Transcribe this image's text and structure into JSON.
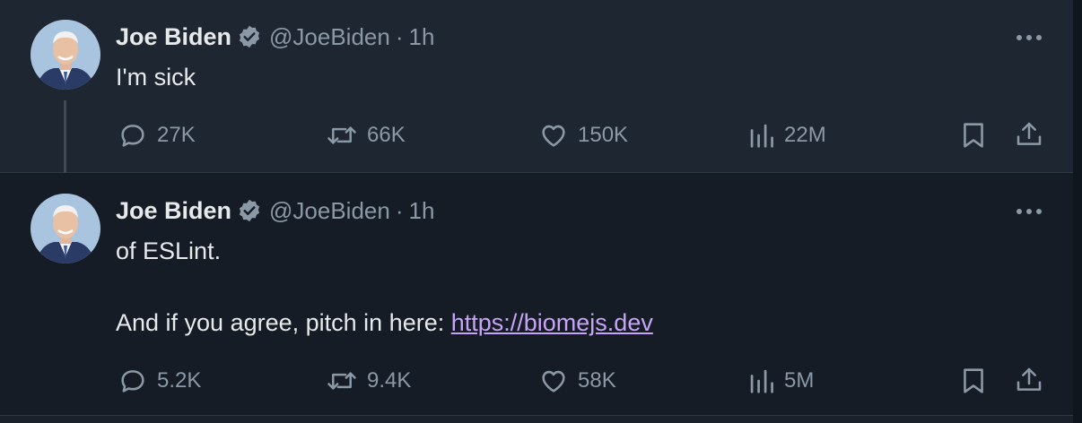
{
  "tweets": [
    {
      "author": {
        "name": "Joe Biden",
        "handle": "@JoeBiden",
        "verified": true
      },
      "separator": "·",
      "time": "1h",
      "text_lines": [
        "I'm sick"
      ],
      "link": "",
      "stats": {
        "replies": "27K",
        "reposts": "66K",
        "likes": "150K",
        "views": "22M"
      }
    },
    {
      "author": {
        "name": "Joe Biden",
        "handle": "@JoeBiden",
        "verified": true
      },
      "separator": "·",
      "time": "1h",
      "text_lines": [
        "of ESLint.",
        "",
        "And if you agree, pitch in here: "
      ],
      "link": "https://biomejs.dev",
      "stats": {
        "replies": "5.2K",
        "reposts": "9.4K",
        "likes": "58K",
        "views": "5M"
      }
    }
  ],
  "icons": {
    "reply": "speech-bubble-icon",
    "repost": "retweet-arrows-icon",
    "like": "heart-icon",
    "views": "bar-chart-icon",
    "bookmark": "bookmark-icon",
    "share": "share-upload-icon",
    "more": "three-dots-icon",
    "verified": "verified-badge-icon"
  },
  "colors": {
    "background_first": "#1e2631",
    "background_second": "#151c25",
    "text": "#e7e9ea",
    "muted": "#8b98a5",
    "link": "#c7a4f5"
  }
}
